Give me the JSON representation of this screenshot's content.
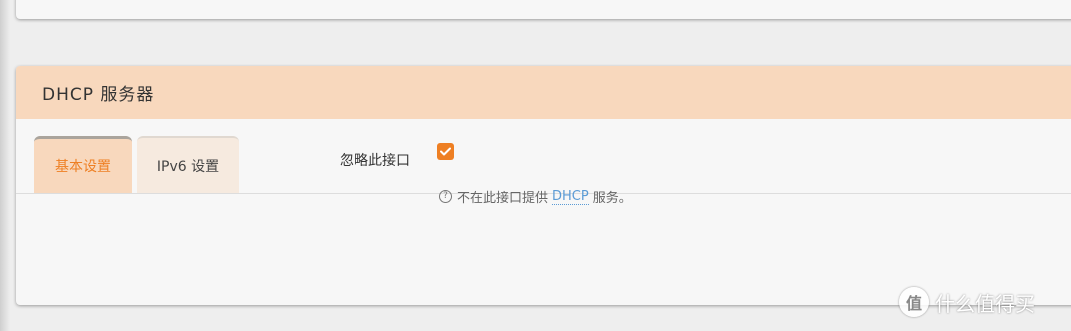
{
  "section": {
    "title": "DHCP 服务器"
  },
  "tabs": [
    {
      "label": "基本设置",
      "active": true
    },
    {
      "label": "IPv6 设置",
      "active": false
    }
  ],
  "options": {
    "ignore_interface": {
      "label": "忽略此接口",
      "checked": true,
      "help_prefix": "不在此接口提供",
      "help_abbr": "DHCP",
      "help_suffix": "服务。"
    }
  },
  "colors": {
    "accent": "#ee7f23",
    "header_bg": "#f8d8bd"
  },
  "watermark": {
    "logo_glyph": "值",
    "text": "什么值得买"
  }
}
